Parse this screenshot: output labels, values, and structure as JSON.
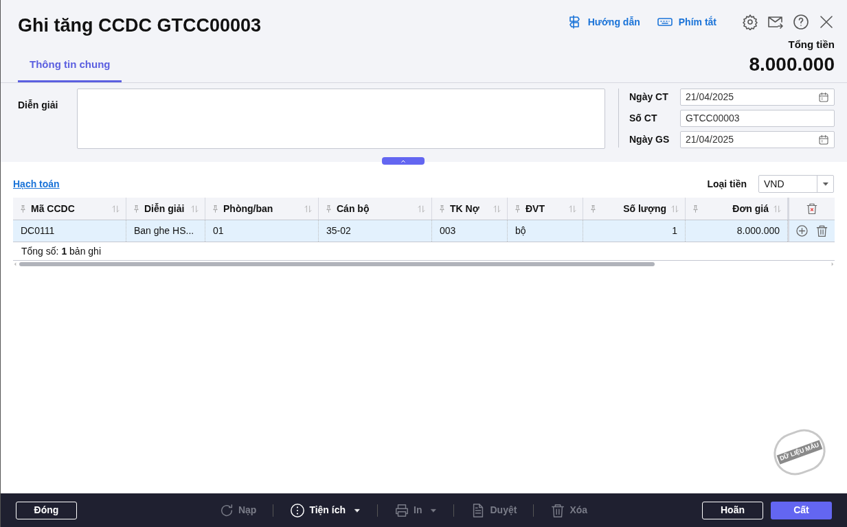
{
  "window": {
    "title": "Ghi tăng CCDC GTCC00003"
  },
  "toolbar": [
    {
      "kind": "guide",
      "label": "Hướng dẫn"
    },
    {
      "kind": "shortcut",
      "label": "Phím tắt"
    },
    {
      "kind": "settings"
    },
    {
      "kind": "mail"
    },
    {
      "kind": "help"
    },
    {
      "kind": "close"
    }
  ],
  "total": {
    "label": "Tổng tiền",
    "value": "8.000.000"
  },
  "tabs": [
    {
      "label": "Thông tin chung",
      "selected": true
    }
  ],
  "form": {
    "description": {
      "label": "Diễn giải"
    },
    "fields": [
      {
        "label": "Ngày CT",
        "value": "21/04/2025",
        "kind": "date"
      },
      {
        "label": "Số CT",
        "value": "GTCC00003",
        "kind": "text"
      },
      {
        "label": "Ngày GS",
        "value": "21/04/2025",
        "kind": "date"
      }
    ]
  },
  "accounting": {
    "link": "Hạch toán",
    "currency_label": "Loại tiền",
    "currency": "VND"
  },
  "table": {
    "columns": [
      {
        "label": "Mã CCDC",
        "kind": "text"
      },
      {
        "label": "Diễn giải",
        "kind": "text"
      },
      {
        "label": "Phòng/ban",
        "kind": "text"
      },
      {
        "label": "Cán bộ",
        "kind": "text"
      },
      {
        "label": "TK Nợ",
        "kind": "text"
      },
      {
        "label": "ĐVT",
        "kind": "text"
      },
      {
        "label": "Số lượng",
        "kind": "number"
      },
      {
        "label": "Đơn giá",
        "kind": "number"
      }
    ],
    "rows": [
      {
        "cells": [
          "DC0111",
          "Ban ghe HS...",
          "01",
          "35-02",
          "003",
          "bộ",
          "1",
          "8.000.000"
        ],
        "selected": true
      }
    ],
    "summary": "Tổng số: **1** bản ghi"
  },
  "stamp": "DỮ LIỆU MẪU",
  "footer": {
    "left": {
      "label": "Đóng"
    },
    "actions": [
      {
        "kind": "reload",
        "label": "Nạp",
        "disabled": true
      },
      {
        "kind": "utility",
        "label": "Tiện ích",
        "disabled": false,
        "dropdown": true
      },
      {
        "kind": "print",
        "label": "In",
        "disabled": true,
        "dropdown": true
      },
      {
        "kind": "approve",
        "label": "Duyệt",
        "disabled": true
      },
      {
        "kind": "delete",
        "label": "Xóa",
        "disabled": true
      }
    ],
    "cancel": {
      "label": "Hoãn"
    },
    "save": {
      "label": "Cất"
    }
  }
}
